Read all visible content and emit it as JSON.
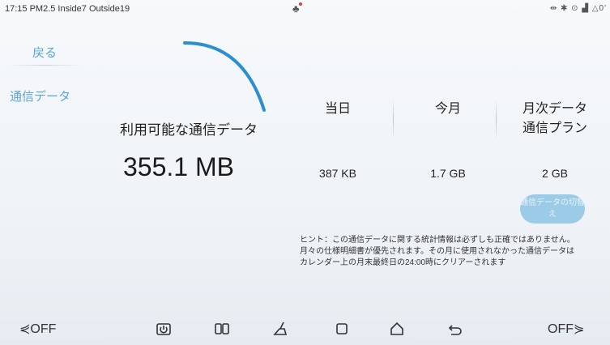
{
  "status_bar": {
    "left_text": "17:15 PM2.5 Inside7 Outside19",
    "center_icon": "notification-icon",
    "right_icons": [
      "usb-icon",
      "bluetooth-icon",
      "location-icon",
      "signal-icon",
      "warning-icon"
    ],
    "right_text": "0'"
  },
  "sidebar": {
    "back_label": "戻る",
    "active_item": "通信データ"
  },
  "main": {
    "available_label": "利用可能な通信データ",
    "available_value": "355.1 MB",
    "columns": [
      {
        "header_line1": "当日",
        "header_line2": "",
        "value": "387 KB"
      },
      {
        "header_line1": "今月",
        "header_line2": "",
        "value": "1.7 GB"
      },
      {
        "header_line1": "月次データ",
        "header_line2": "通信プラン",
        "value": "2 GB"
      }
    ],
    "swap_button_label": "通信データの切替え",
    "hint_lines": [
      "ヒント：この通信データに関する統計情報は必ずしも正確ではありません。",
      "月々の仕様明細書が優先されます。その月に使用されなかった通信データは",
      "カレンダー上の月末最終日の24:00時にクリアーされます"
    ]
  },
  "bottom_bar": {
    "left_label": "OFF",
    "right_label": "OFF",
    "icons": [
      "power-icon",
      "split-screen-icon",
      "clean-icon",
      "recent-apps-icon",
      "home-icon",
      "back-icon"
    ]
  },
  "colors": {
    "accent": "#2a8fd0",
    "sidebar_text": "#5aa6d6",
    "button_bg": "#8ec5e6"
  }
}
